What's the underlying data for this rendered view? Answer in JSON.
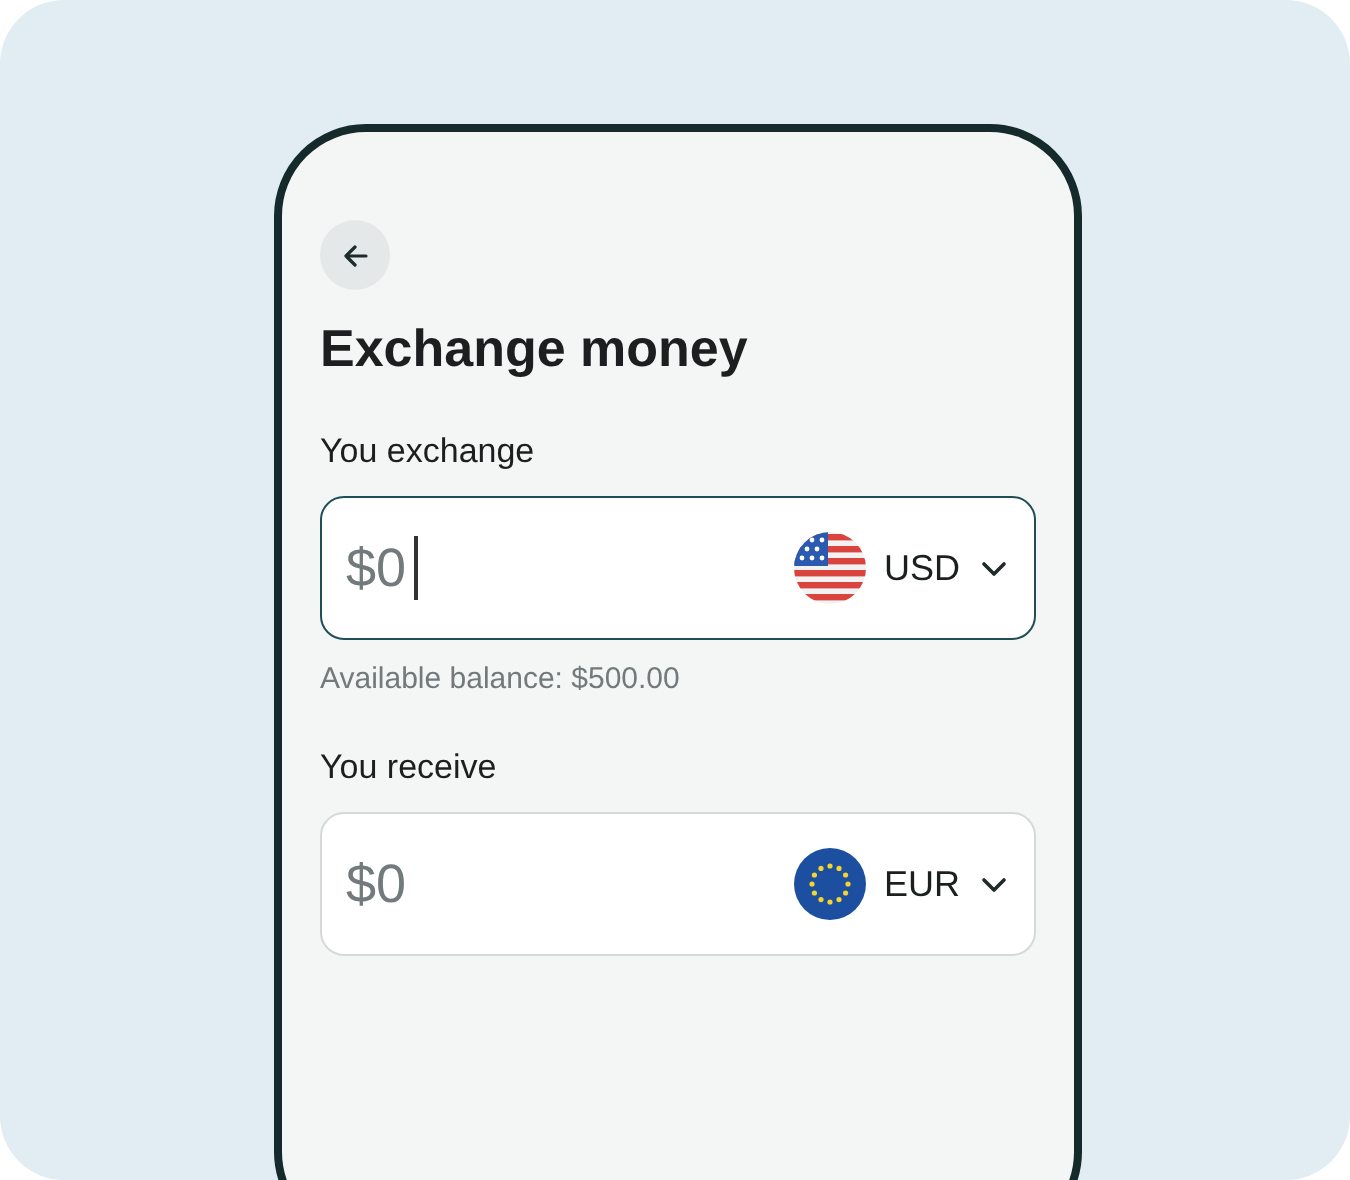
{
  "title": "Exchange money",
  "fields": [
    {
      "label": "You exchange",
      "placeholder": "$0",
      "focused": true,
      "currency": "USD",
      "kind": "us",
      "helper": "Available balance: $500.00"
    },
    {
      "label": "You receive",
      "placeholder": "$0",
      "focused": false,
      "currency": "EUR",
      "kind": "eu"
    }
  ]
}
